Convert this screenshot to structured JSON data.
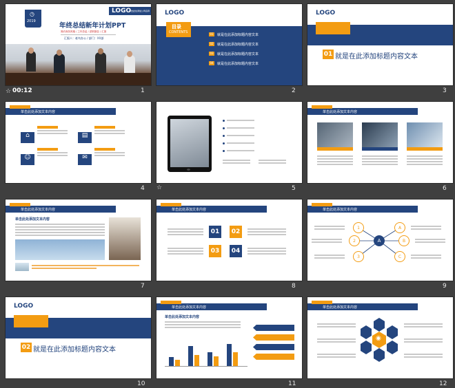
{
  "slides": [
    {
      "num": "1",
      "timer": "00:12",
      "logo": "LOGO",
      "logo_sub": "单击此处添加公司名称",
      "year": "2019",
      "title": "年终总结新年计划PPT",
      "sub1": "简约商务风格 / 工作总结 / 述职报告 / 汇报",
      "reporter": "汇报人：老鸟办公 / 部门：XX部"
    },
    {
      "num": "2",
      "logo": "LOGO",
      "tag_cn": "目录",
      "tag_en": "CONTENTS",
      "items": [
        {
          "n": "01",
          "t": "就是在此添加标题内容文本"
        },
        {
          "n": "02",
          "t": "就是在此添加标题内容文本"
        },
        {
          "n": "03",
          "t": "就是在此添加标题内容文本"
        },
        {
          "n": "04",
          "t": "就是在此添加标题内容文本"
        }
      ]
    },
    {
      "num": "3",
      "logo": "LOGO",
      "badge": "01",
      "title": "就是在此添加标题内容文本"
    },
    {
      "num": "4",
      "header": "单击此处添加文本内容"
    },
    {
      "num": "5",
      "icon": "☆"
    },
    {
      "num": "6",
      "header": "单击此处添加文本内容"
    },
    {
      "num": "7",
      "header": "单击此处添加文本内容",
      "subtitle": "单击此处添加文本内容"
    },
    {
      "num": "8",
      "header": "单击此处添加文本内容",
      "items": [
        "01",
        "02",
        "03",
        "04"
      ]
    },
    {
      "num": "9",
      "header": "单击此处添加文本内容",
      "left": [
        "1",
        "2",
        "3"
      ],
      "right": [
        "A",
        "B",
        "C"
      ],
      "center": "A"
    },
    {
      "num": "10",
      "logo": "LOGO",
      "badge": "02",
      "title": "就是在此添加标题内容文本"
    },
    {
      "num": "11",
      "header": "单击此处添加文本内容",
      "subtitle": "单击此处添加文本内容",
      "bars": [
        {
          "a": 0.35,
          "b": 0.25
        },
        {
          "a": 0.8,
          "b": 0.45
        },
        {
          "a": 0.55,
          "b": 0.4
        },
        {
          "a": 0.9,
          "b": 0.55
        }
      ]
    },
    {
      "num": "12",
      "header": "单击此处添加文本内容",
      "wifi": "wifi-icon"
    }
  ]
}
